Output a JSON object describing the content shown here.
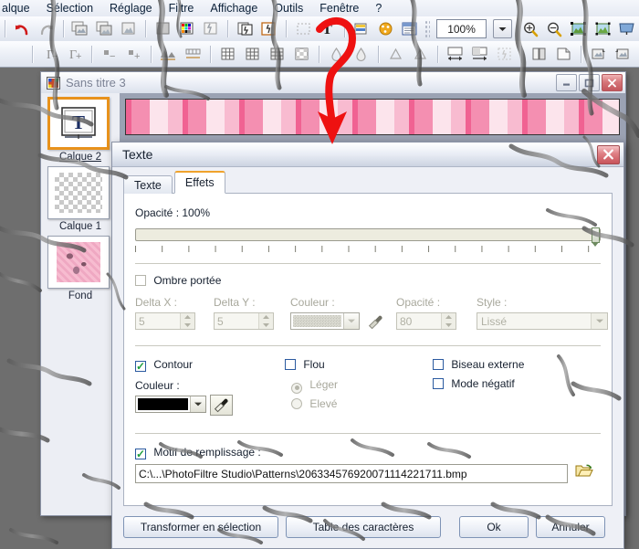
{
  "menubar": {
    "items": [
      {
        "label": "alque"
      },
      {
        "label": "Sélection"
      },
      {
        "label": "Réglage"
      },
      {
        "label": "Filtre"
      },
      {
        "label": "Affichage"
      },
      {
        "label": "Outils"
      },
      {
        "label": "Fenêtre"
      },
      {
        "label": "?"
      }
    ]
  },
  "toolbar": {
    "zoom_value": "100%",
    "icons_row1": [
      "undo-icon",
      "redo-icon",
      "duplicate-image-icon",
      "transparent-image-icon",
      "crop-image-icon",
      "fill-color-icon",
      "palette-icon",
      "transform-icon",
      "layer-forward-icon",
      "layer-framed-icon",
      "select-dashed-icon",
      "text-tool-icon",
      "gradient-icon",
      "paint-palette-icon",
      "dialog-icon"
    ],
    "icons_row2": [
      "gamma-minus-icon",
      "gamma-plus-icon",
      "brightness-minus-icon",
      "brightness-plus-icon",
      "histogram-icon",
      "levels-icon",
      "grid-1-icon",
      "grid-2-icon",
      "grid-3-icon",
      "checker-icon",
      "blur-icon",
      "drop-icon",
      "sharpen-1-icon",
      "sharpen-2-icon",
      "resize-width-icon",
      "resize-canvas-icon",
      "transform-sel-icon",
      "mirror-icon",
      "page-fold-icon",
      "rotate-cw-icon",
      "rotate-ccw-icon"
    ]
  },
  "child_window": {
    "title": "Sans titre 3",
    "icon": "image-document-icon",
    "buttons": {
      "minimize": "minimize-icon",
      "maximize": "maximize-icon",
      "close": "close-icon"
    },
    "layers": [
      {
        "name": "Calque 2",
        "thumb": "text-layer-thumb",
        "selected": true
      },
      {
        "name": "Calque 1",
        "thumb": "transparent-layer-thumb",
        "selected": false
      },
      {
        "name": "Fond",
        "thumb": "pink-texture-thumb",
        "selected": false
      }
    ]
  },
  "dialog": {
    "title": "Texte",
    "close_icon": "close-icon",
    "tabs": [
      {
        "label": "Texte",
        "active": false
      },
      {
        "label": "Effets",
        "active": true
      }
    ],
    "opacity": {
      "label": "Opacité : 100%",
      "value": 100,
      "min": 0,
      "max": 100
    },
    "shadow": {
      "checkbox_label": "Ombre portée",
      "checked": false,
      "delta_x": {
        "label": "Delta X :",
        "value": "5"
      },
      "delta_y": {
        "label": "Delta Y :",
        "value": "5"
      },
      "color": {
        "label": "Couleur :",
        "swatch": "#b3b3a8",
        "eyedropper": "eyedropper-icon"
      },
      "opacity": {
        "label": "Opacité :",
        "value": "80"
      },
      "style": {
        "label": "Style :",
        "value": "Lissé"
      }
    },
    "contour": {
      "checkbox_label": "Contour",
      "checked": true,
      "color_label": "Couleur :",
      "color_value": "#000000",
      "eyedropper": "eyedropper-icon"
    },
    "flou": {
      "checkbox_label": "Flou",
      "checked": false,
      "options": [
        {
          "label": "Léger",
          "selected": true
        },
        {
          "label": "Elevé",
          "selected": false
        }
      ]
    },
    "right_options": [
      {
        "label": "Biseau externe",
        "checked": false
      },
      {
        "label": "Mode négatif",
        "checked": false
      }
    ],
    "pattern": {
      "checkbox_label": "Motif de remplissage :",
      "checked": true,
      "path": "C:\\...\\PhotoFiltre Studio\\Patterns\\206334576920071114221711.bmp",
      "browse_icon": "open-folder-icon"
    },
    "buttons": [
      {
        "label": "Transformer en sélection"
      },
      {
        "label": "Table des caractères"
      },
      {
        "label": "Ok"
      },
      {
        "label": "Annuler"
      }
    ]
  },
  "colors": {
    "accent_orange": "#e8921c",
    "close_red": "#c8545b",
    "check_green": "#1e9e3c",
    "annotation_red": "#ee1111",
    "pattern_pink": "#f48fb6"
  }
}
